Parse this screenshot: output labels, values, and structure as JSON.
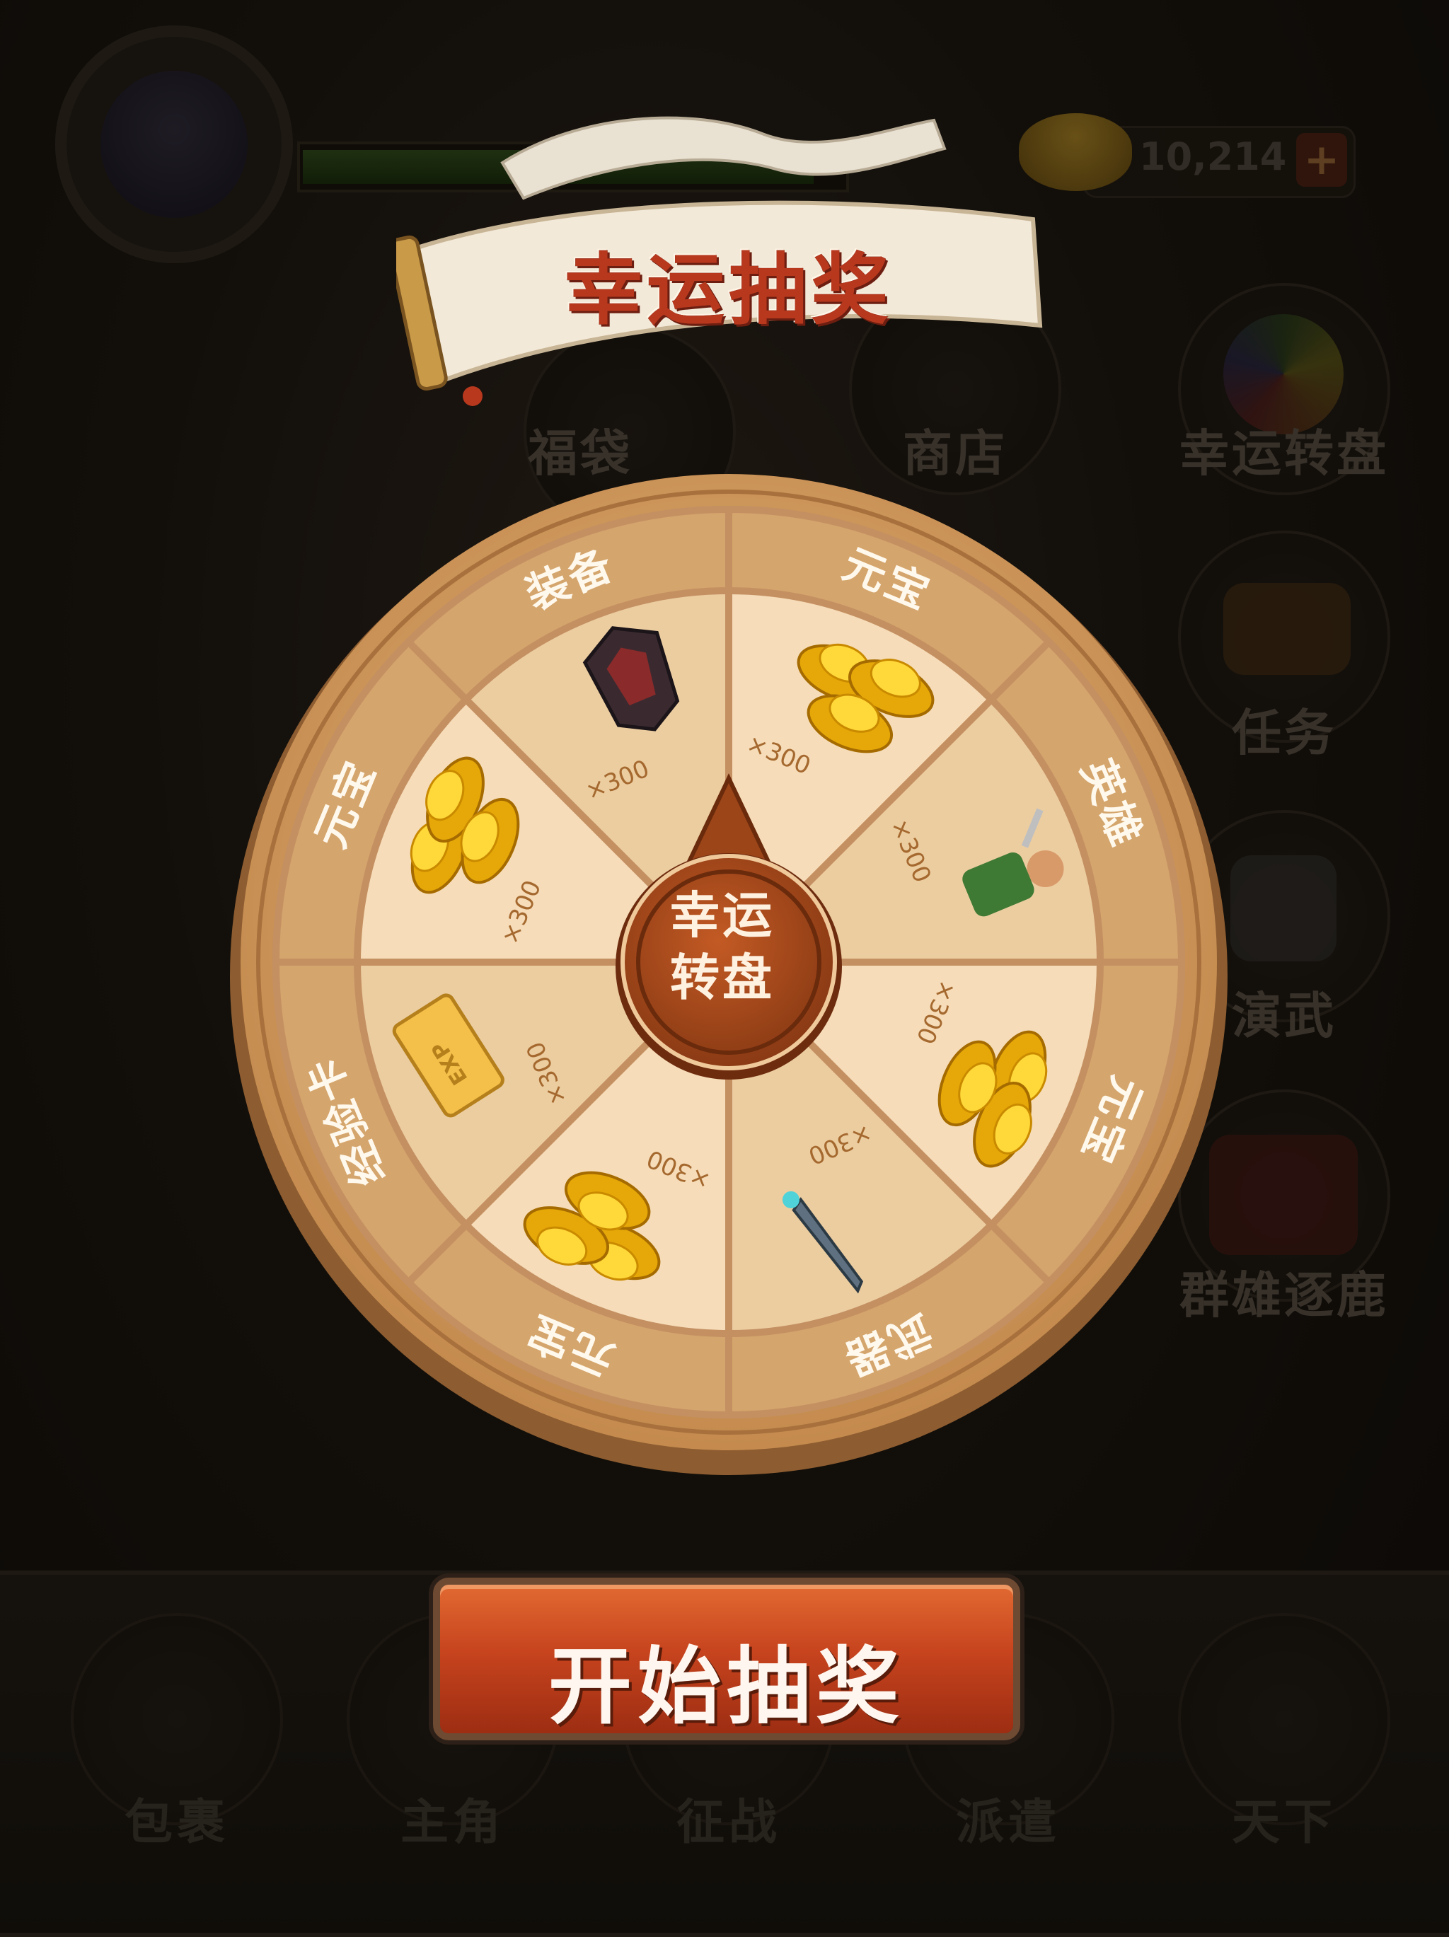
{
  "title": "幸运抽奖",
  "player": {
    "gold": "10,214",
    "hp_fraction": 0.95,
    "add_gold_label": "+"
  },
  "side_menu": [
    {
      "id": "fudai",
      "label": "福袋"
    },
    {
      "id": "shop",
      "label": "商店"
    },
    {
      "id": "lucky_wheel",
      "label": "幸运转盘"
    },
    {
      "id": "task",
      "label": "任务"
    },
    {
      "id": "drill",
      "label": "演武"
    },
    {
      "id": "rank",
      "label": "群雄逐鹿"
    }
  ],
  "bottom_nav": [
    {
      "id": "bag",
      "label": "包裹"
    },
    {
      "id": "hero",
      "label": "主角"
    },
    {
      "id": "battle",
      "label": "征战"
    },
    {
      "id": "dispatch",
      "label": "派遣"
    },
    {
      "id": "world",
      "label": "天下"
    }
  ],
  "wheel": {
    "hub_line1": "幸运",
    "hub_line2": "转盘",
    "segments": [
      {
        "name": "元宝",
        "qty": "×300",
        "icon": "gold-ingot-icon"
      },
      {
        "name": "英雄",
        "qty": "×300",
        "icon": "hero-icon"
      },
      {
        "name": "元宝",
        "qty": "×300",
        "icon": "gold-ingot-icon"
      },
      {
        "name": "武器",
        "qty": "×300",
        "icon": "sword-icon"
      },
      {
        "name": "元宝",
        "qty": "×300",
        "icon": "gold-ingot-icon"
      },
      {
        "name": "经验卡",
        "qty": "×300",
        "icon": "exp-card-icon",
        "card_text": "EXP"
      },
      {
        "name": "元宝",
        "qty": "×300",
        "icon": "gold-ingot-icon"
      },
      {
        "name": "装备",
        "qty": "×300",
        "icon": "armor-icon"
      }
    ]
  },
  "start_button": "开始抽奖",
  "colors": {
    "accent": "#c7441e",
    "wheel_rim": "#d9aa72",
    "segment_light": "#f6dcb8",
    "segment_dark": "#eccda0",
    "hub": "#a24a1c"
  }
}
